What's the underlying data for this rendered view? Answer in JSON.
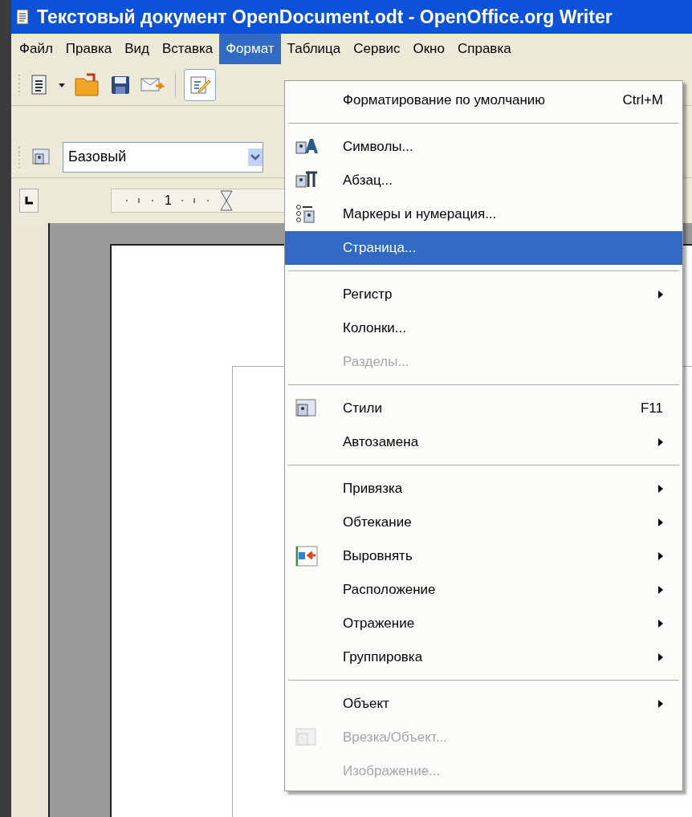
{
  "window": {
    "title": "Текстовый документ OpenDocument.odt - OpenOffice.org Writer"
  },
  "menubar": [
    {
      "label": "Файл",
      "selected": false
    },
    {
      "label": "Правка",
      "selected": false
    },
    {
      "label": "Вид",
      "selected": false
    },
    {
      "label": "Вставка",
      "selected": false
    },
    {
      "label": "Формат",
      "selected": true
    },
    {
      "label": "Таблица",
      "selected": false
    },
    {
      "label": "Сервис",
      "selected": false
    },
    {
      "label": "Окно",
      "selected": false
    },
    {
      "label": "Справка",
      "selected": false
    }
  ],
  "toolbar": {
    "edit_mode": {
      "on": true
    }
  },
  "formatting_bar": {
    "paragraph_style": "Базовый"
  },
  "ruler": {
    "number": "1"
  },
  "format_menu": [
    {
      "kind": "item",
      "label": "Форматирование по умолчанию",
      "shortcut": "Ctrl+M",
      "selected": false,
      "disabled": false,
      "submenu": false
    },
    {
      "kind": "separator"
    },
    {
      "kind": "item",
      "label": "Символы...",
      "selected": false,
      "disabled": false,
      "submenu": false
    },
    {
      "kind": "item",
      "label": "Абзац...",
      "selected": false,
      "disabled": false,
      "submenu": false
    },
    {
      "kind": "item",
      "label": "Маркеры и нумерация...",
      "selected": false,
      "disabled": false,
      "submenu": false
    },
    {
      "kind": "item",
      "label": "Страница...",
      "selected": true,
      "disabled": false,
      "submenu": false
    },
    {
      "kind": "separator"
    },
    {
      "kind": "item",
      "label": "Регистр",
      "selected": false,
      "disabled": false,
      "submenu": true
    },
    {
      "kind": "item",
      "label": "Колонки...",
      "selected": false,
      "disabled": false,
      "submenu": false
    },
    {
      "kind": "item",
      "label": "Разделы...",
      "selected": false,
      "disabled": true,
      "submenu": false
    },
    {
      "kind": "separator"
    },
    {
      "kind": "item",
      "label": "Стили",
      "shortcut": "F11",
      "selected": false,
      "disabled": false,
      "submenu": false
    },
    {
      "kind": "item",
      "label": "Автозамена",
      "selected": false,
      "disabled": false,
      "submenu": true
    },
    {
      "kind": "separator"
    },
    {
      "kind": "item",
      "label": "Привязка",
      "selected": false,
      "disabled": false,
      "submenu": true
    },
    {
      "kind": "item",
      "label": "Обтекание",
      "selected": false,
      "disabled": false,
      "submenu": true
    },
    {
      "kind": "item",
      "label": "Выровнять",
      "selected": false,
      "disabled": false,
      "submenu": true
    },
    {
      "kind": "item",
      "label": "Расположение",
      "selected": false,
      "disabled": false,
      "submenu": true
    },
    {
      "kind": "item",
      "label": "Отражение",
      "selected": false,
      "disabled": false,
      "submenu": true
    },
    {
      "kind": "item",
      "label": "Группировка",
      "selected": false,
      "disabled": false,
      "submenu": true
    },
    {
      "kind": "separator"
    },
    {
      "kind": "item",
      "label": "Объект",
      "selected": false,
      "disabled": false,
      "submenu": true
    },
    {
      "kind": "item",
      "label": "Врезка/Объект...",
      "selected": false,
      "disabled": true,
      "submenu": false
    },
    {
      "kind": "item",
      "label": "Изображение...",
      "selected": false,
      "disabled": true,
      "submenu": false
    }
  ]
}
